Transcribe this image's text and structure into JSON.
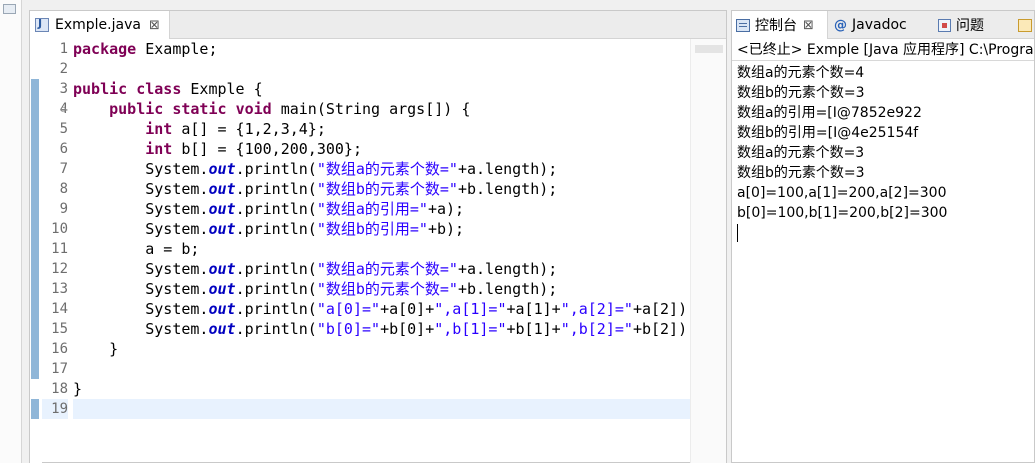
{
  "editor": {
    "tab_label": "Exmple.java",
    "tab_close": "⊠",
    "line_numbers": [
      "1",
      "2",
      "3",
      "4",
      "5",
      "6",
      "7",
      "8",
      "9",
      "10",
      "11",
      "12",
      "13",
      "14",
      "15",
      "16",
      "17",
      "18",
      "19"
    ],
    "code": {
      "l1": {
        "kw": "package",
        "rest": " Example;"
      },
      "l3": {
        "kw1": "public",
        "kw2": "class",
        "rest": " Exmple {"
      },
      "l4": {
        "indent": "    ",
        "kw1": "public",
        "kw2": "static",
        "kw3": "void",
        "rest": " main(String args[]) {"
      },
      "l5": {
        "indent": "        ",
        "kw": "int",
        "rest": " a[] = {1,2,3,4};"
      },
      "l6": {
        "indent": "        ",
        "kw": "int",
        "rest": " b[] = {100,200,300};"
      },
      "sys": "System.",
      "out": "out",
      "println": ".println(",
      "l7": {
        "str": "\"数组a的元素个数=\"",
        "rest": "+a.length);"
      },
      "l8": {
        "str": "\"数组b的元素个数=\"",
        "rest": "+b.length);"
      },
      "l9": {
        "str": "\"数组a的引用=\"",
        "rest": "+a);"
      },
      "l10": {
        "str": "\"数组b的引用=\"",
        "rest": "+b);"
      },
      "l11": {
        "text": "        a = b;"
      },
      "l12": {
        "str": "\"数组a的元素个数=\"",
        "rest": "+a.length);"
      },
      "l13": {
        "str": "\"数组b的元素个数=\"",
        "rest": "+b.length);"
      },
      "l14": {
        "s1": "\"a[0]=\"",
        "r1": "+a[0]+",
        "s2": "\",a[1]=\"",
        "r2": "+a[1]+",
        "s3": "\",a[2]=\"",
        "r3": "+a[2]);"
      },
      "l15": {
        "s1": "\"b[0]=\"",
        "r1": "+b[0]+",
        "s2": "\",b[1]=\"",
        "r2": "+b[1]+",
        "s3": "\",b[2]=\"",
        "r3": "+b[2]);"
      },
      "l16": {
        "text": "    }"
      },
      "l18": {
        "text": "}"
      }
    }
  },
  "console": {
    "tabs": [
      {
        "label": "控制台",
        "close": "⊠"
      },
      {
        "label": "Javadoc"
      },
      {
        "label": "问题"
      }
    ],
    "header": "<已终止> Exmple [Java 应用程序] C:\\Progra",
    "output": [
      "数组a的元素个数=4",
      "数组b的元素个数=3",
      "数组a的引用=[I@7852e922",
      "数组b的引用=[I@4e25154f",
      "数组a的元素个数=3",
      "数组b的元素个数=3",
      "a[0]=100,a[1]=200,a[2]=300",
      "b[0]=100,b[1]=200,b[2]=300"
    ]
  },
  "colors": {
    "keyword": "#7f0055",
    "string": "#2a00ff",
    "static_field": "#0000c0",
    "current_line": "#e8f2fe",
    "change_bar": "#8fb6d8"
  }
}
